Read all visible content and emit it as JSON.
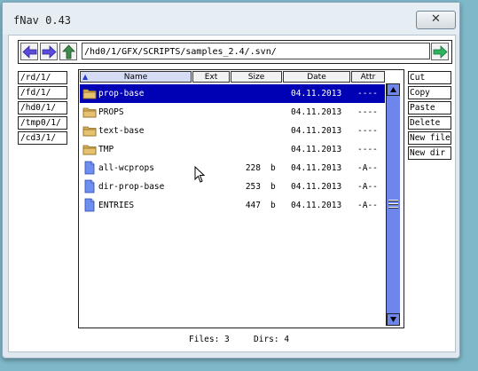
{
  "window": {
    "title": "fNav 0.43",
    "close_glyph": "✕"
  },
  "toolbar": {
    "back_icon": "arrow-left-icon",
    "forward_icon": "arrow-right-icon",
    "up_icon": "arrow-up-icon",
    "go_icon": "arrow-go-icon",
    "path": "/hd0/1/GFX/SCRIPTS/samples_2.4/.svn/"
  },
  "drives": [
    "/rd/1/",
    "/fd/1/",
    "/hd0/1/",
    "/tmp0/1/",
    "/cd3/1/"
  ],
  "columns": {
    "name": "Name",
    "ext": "Ext",
    "size": "Size",
    "date": "Date",
    "attr": "Attr"
  },
  "files": [
    {
      "type": "folder",
      "name": "prop-base",
      "size": "",
      "unit": "",
      "date": "04.11.2013",
      "attr": "----",
      "selected": true
    },
    {
      "type": "folder",
      "name": "PROPS",
      "size": "",
      "unit": "",
      "date": "04.11.2013",
      "attr": "----",
      "selected": false
    },
    {
      "type": "folder",
      "name": "text-base",
      "size": "",
      "unit": "",
      "date": "04.11.2013",
      "attr": "----",
      "selected": false
    },
    {
      "type": "folder",
      "name": "TMP",
      "size": "",
      "unit": "",
      "date": "04.11.2013",
      "attr": "----",
      "selected": false
    },
    {
      "type": "file",
      "name": "all-wcprops",
      "size": "228",
      "unit": "b",
      "date": "04.11.2013",
      "attr": "-A--",
      "selected": false
    },
    {
      "type": "file",
      "name": "dir-prop-base",
      "size": "253",
      "unit": "b",
      "date": "04.11.2013",
      "attr": "-A--",
      "selected": false
    },
    {
      "type": "file",
      "name": "ENTRIES",
      "size": "447",
      "unit": "b",
      "date": "04.11.2013",
      "attr": "-A--",
      "selected": false
    }
  ],
  "actions": [
    "Cut",
    "Copy",
    "Paste",
    "Delete",
    "New file",
    "New dir"
  ],
  "status": {
    "files": "Files: 3",
    "dirs": "Dirs: 4"
  },
  "colors": {
    "selection": "#0000b4",
    "scrollbar": "#6e86ec",
    "folder": "#d8b15a",
    "file": "#6d8ff0",
    "nav_arrow": "#5b4bd8",
    "up_arrow": "#3d8a4a",
    "go_arrow": "#2db55d"
  }
}
